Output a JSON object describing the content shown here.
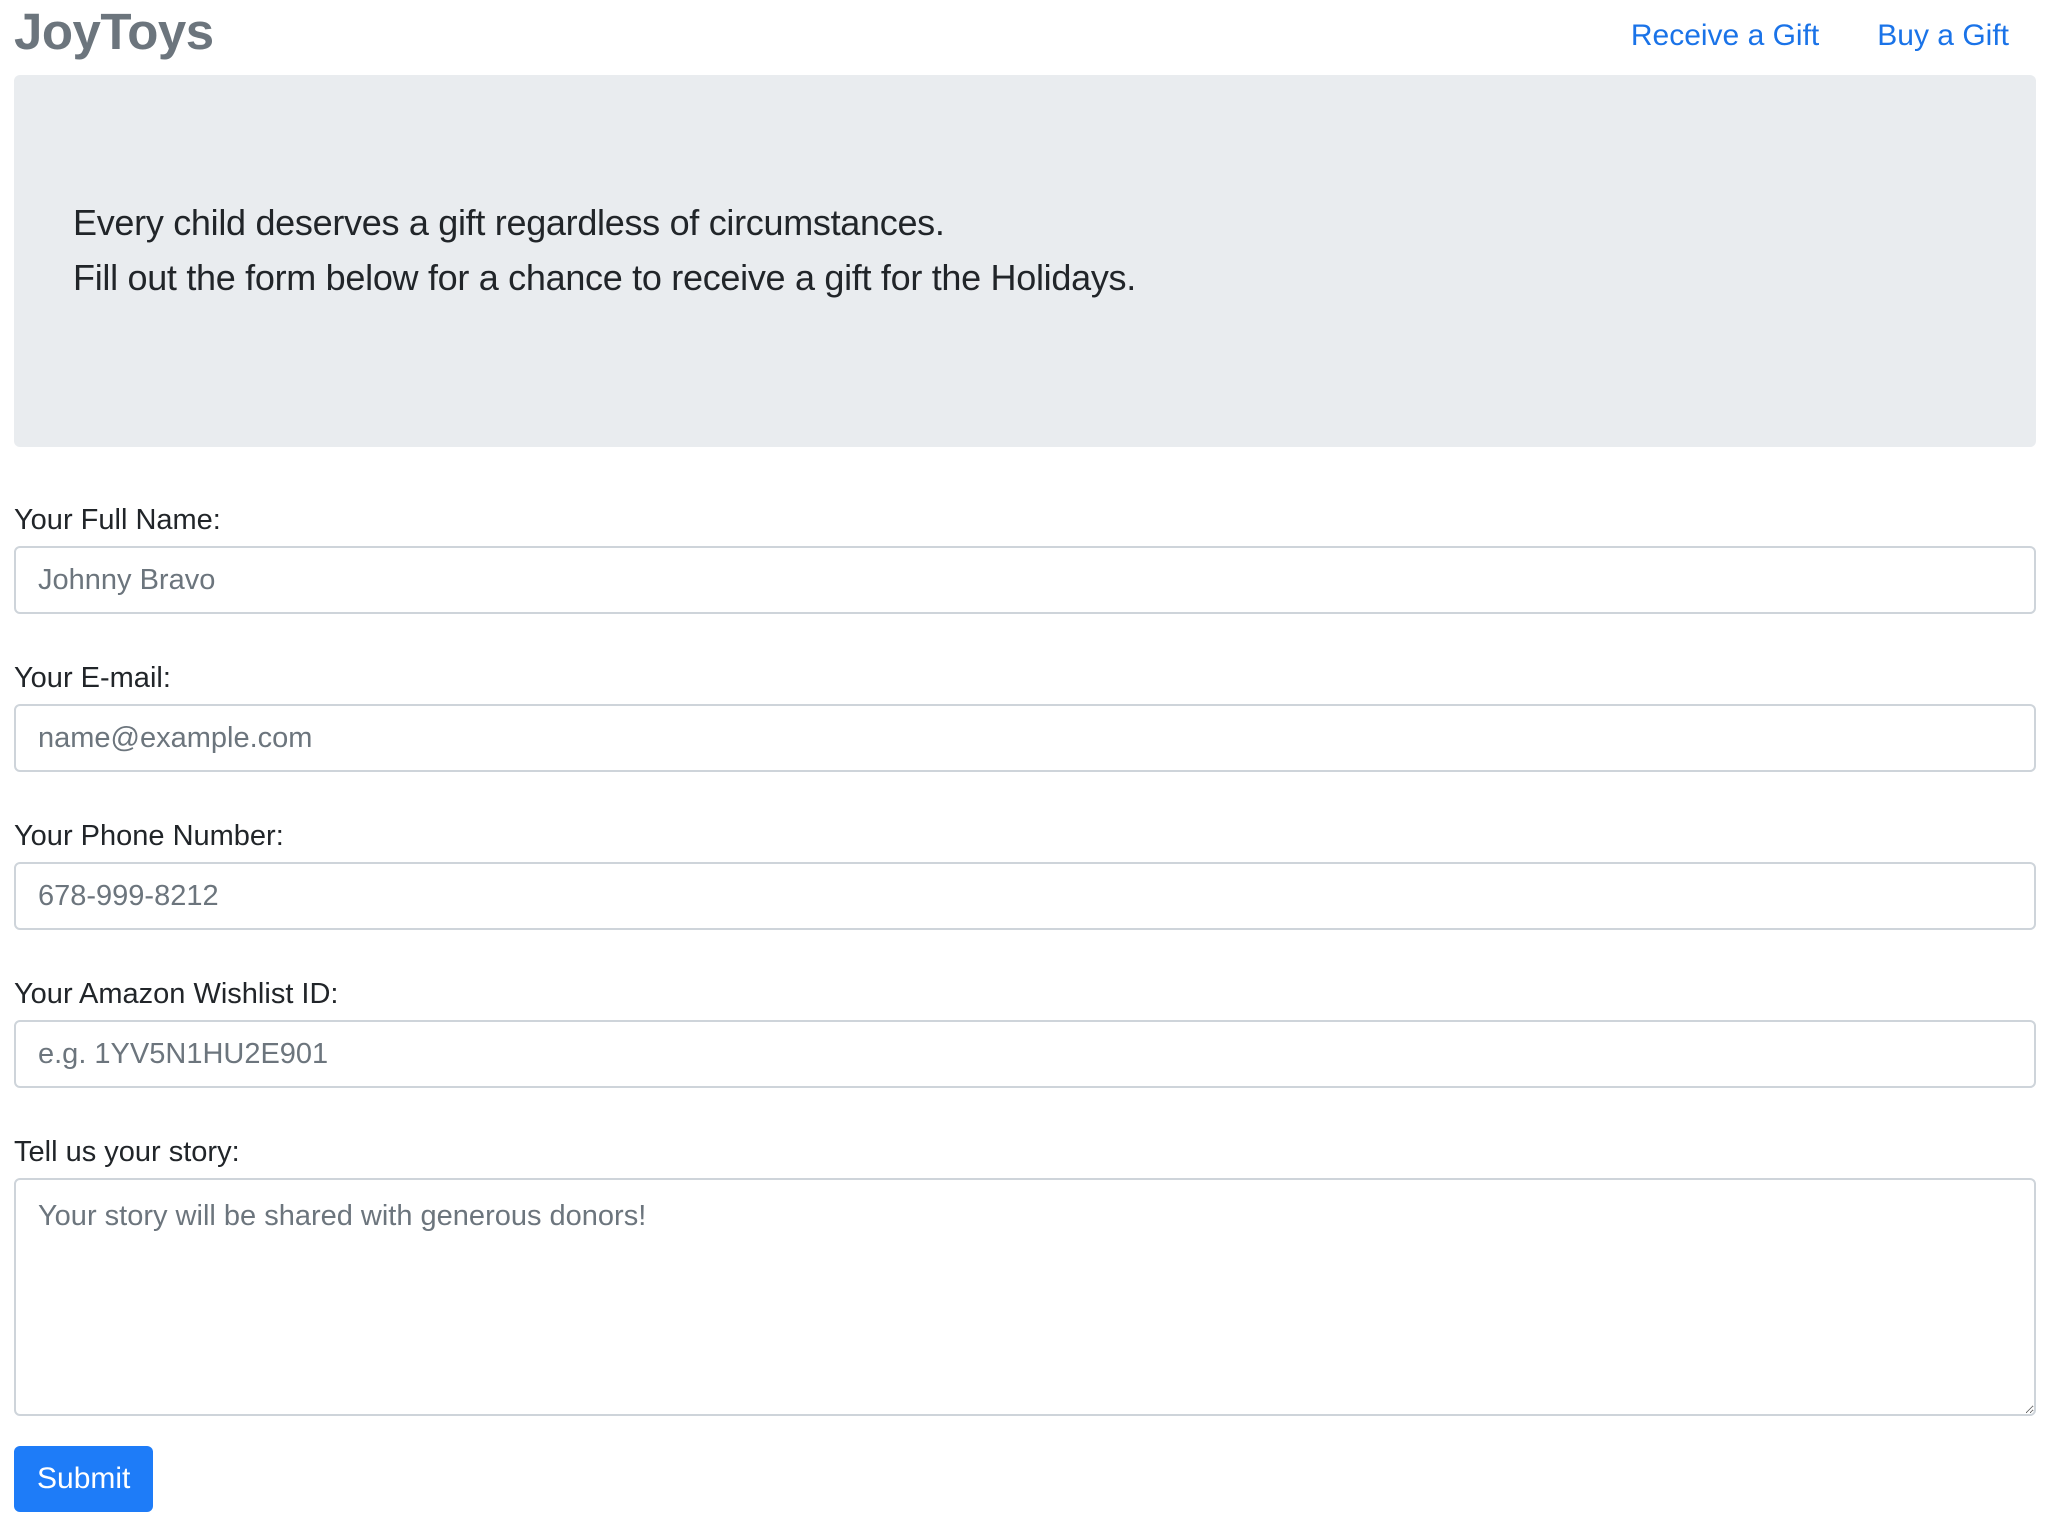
{
  "navbar": {
    "brand": "JoyToys",
    "links": [
      {
        "label": "Receive a Gift"
      },
      {
        "label": "Buy a Gift"
      }
    ]
  },
  "hero": {
    "line1": "Every child deserves a gift regardless of circumstances.",
    "line2": "Fill out the form below for a chance to receive a gift for the Holidays."
  },
  "form": {
    "full_name": {
      "label": "Your Full Name:",
      "placeholder": "Johnny Bravo",
      "value": ""
    },
    "email": {
      "label": "Your E-mail:",
      "placeholder": "name@example.com",
      "value": ""
    },
    "phone": {
      "label": "Your Phone Number:",
      "placeholder": "678-999-8212",
      "value": ""
    },
    "wishlist": {
      "label": "Your Amazon Wishlist ID:",
      "placeholder": "e.g. 1YV5N1HU2E901",
      "value": ""
    },
    "story": {
      "label": "Tell us your story:",
      "placeholder": "Your story will be shared with generous donors!",
      "value": ""
    },
    "submit_label": "Submit"
  },
  "colors": {
    "link": "#1a73e8",
    "brand": "#6c757d",
    "jumbotron_bg": "#e9ecef",
    "button_bg": "#1e7cf8"
  }
}
